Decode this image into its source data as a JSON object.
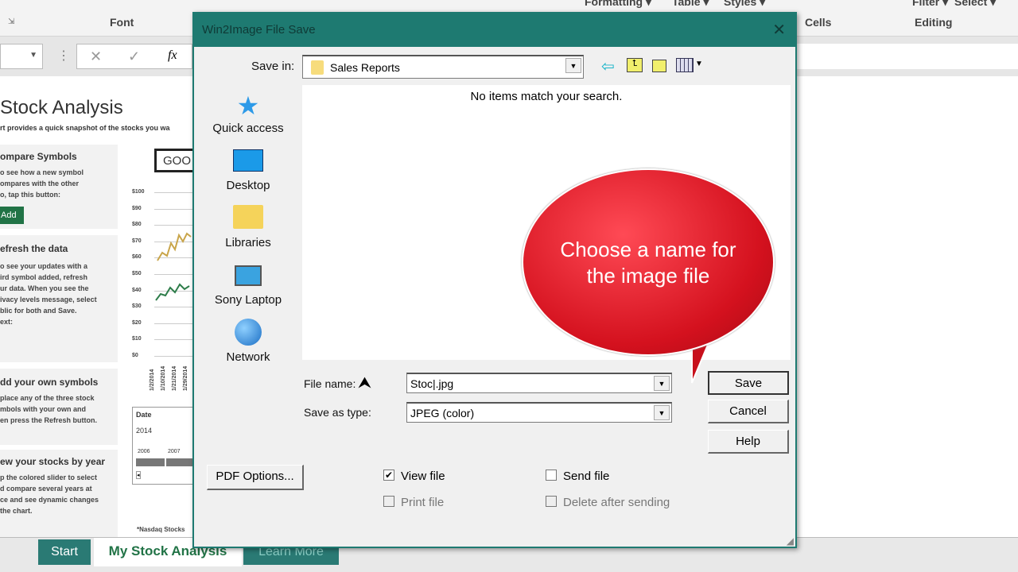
{
  "excel": {
    "ribbon": {
      "font": "Font",
      "formatting": "Formatting ▾",
      "table": "Table ▾",
      "styles": "Styles ▾",
      "cells": "Cells",
      "editing": "Editing",
      "filter": "Filter ▾",
      "select": "Select ▾"
    },
    "sheet": {
      "title": "Stock Analysis",
      "subtitle": "rt provides a quick snapshot of the stocks you wa",
      "symbol": "GOO",
      "cards": [
        {
          "title": "ompare Symbols",
          "body": "o see how a new symbol\nompares with the other\no, tap this button:",
          "button": "Add"
        },
        {
          "title": "efresh the data",
          "body": "o see your updates with a\nird symbol added, refresh\nur data. When you see the\nivacy levels message, select\nblic for both and Save.\next:"
        },
        {
          "title": "dd your own symbols",
          "body": "place any of the three stock\nmbols with your own and\nen press the Refresh button."
        },
        {
          "title": "ew your stocks by year",
          "body": "p the colored slider to select\nd compare several years at\nce and see dynamic changes\nthe chart."
        }
      ],
      "yticks": [
        "$100",
        "$90",
        "$80",
        "$70",
        "$60",
        "$50",
        "$40",
        "$30",
        "$20",
        "$10",
        "$0"
      ],
      "xticks": [
        "1/2/2014",
        "1/10/2014",
        "1/21/2014",
        "1/29/2014"
      ],
      "slicer": {
        "header": "Date",
        "value": "2014",
        "years": [
          "2006",
          "2007"
        ]
      },
      "footnote": "*Nasdaq Stocks"
    },
    "tabs": [
      "Start",
      "My Stock Analysis",
      "Learn More"
    ]
  },
  "dialog": {
    "title": "Win2Image File Save",
    "save_in_label": "Save in:",
    "save_in_value": "Sales Reports",
    "empty_message": "No items match your search.",
    "places": [
      {
        "label": "Quick access",
        "icon": "star-icon"
      },
      {
        "label": "Desktop",
        "icon": "desktop-icon"
      },
      {
        "label": "Libraries",
        "icon": "libraries-icon"
      },
      {
        "label": "Sony Laptop",
        "icon": "computer-icon"
      },
      {
        "label": "Network",
        "icon": "network-icon"
      }
    ],
    "file_name_label": "File name:",
    "file_name_value": "Stoc|.jpg",
    "save_type_label": "Save as type:",
    "save_type_value": "JPEG (color)",
    "buttons": {
      "save": "Save",
      "cancel": "Cancel",
      "help": "Help",
      "pdf": "PDF Options..."
    },
    "checkboxes": [
      {
        "label": "View file",
        "checked": true,
        "enabled": true
      },
      {
        "label": "Send file",
        "checked": false,
        "enabled": true
      },
      {
        "label": "Print file",
        "checked": false,
        "enabled": false
      },
      {
        "label": "Delete after sending",
        "checked": false,
        "enabled": false
      }
    ]
  },
  "callout": {
    "text": "Choose a name for the image file",
    "color": "#d4111e"
  }
}
